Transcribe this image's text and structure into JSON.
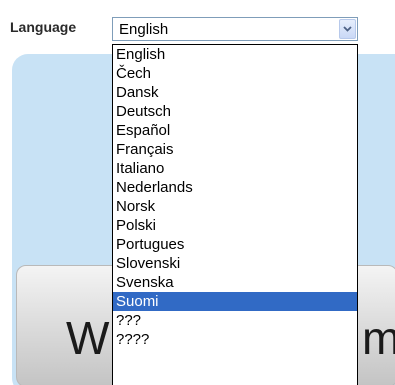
{
  "language_label": "Language",
  "select": {
    "current_value": "English",
    "arrow_icon": "chevron-down-icon"
  },
  "dropdown": {
    "highlighted": "Suomi",
    "items": [
      "English",
      "Čech",
      "Dansk",
      "Deutsch",
      "Español",
      "Français",
      "Italiano",
      "Nederlands",
      "Norsk",
      "Polski",
      "Portugues",
      "Slovenski",
      "Svenska",
      "Suomi",
      "???",
      "????"
    ]
  },
  "background": {
    "headline_left": "W",
    "headline_right": "m"
  },
  "colors": {
    "highlight": "#316ac5",
    "panel": "#c8e2f5",
    "select_border": "#7f9db9"
  }
}
